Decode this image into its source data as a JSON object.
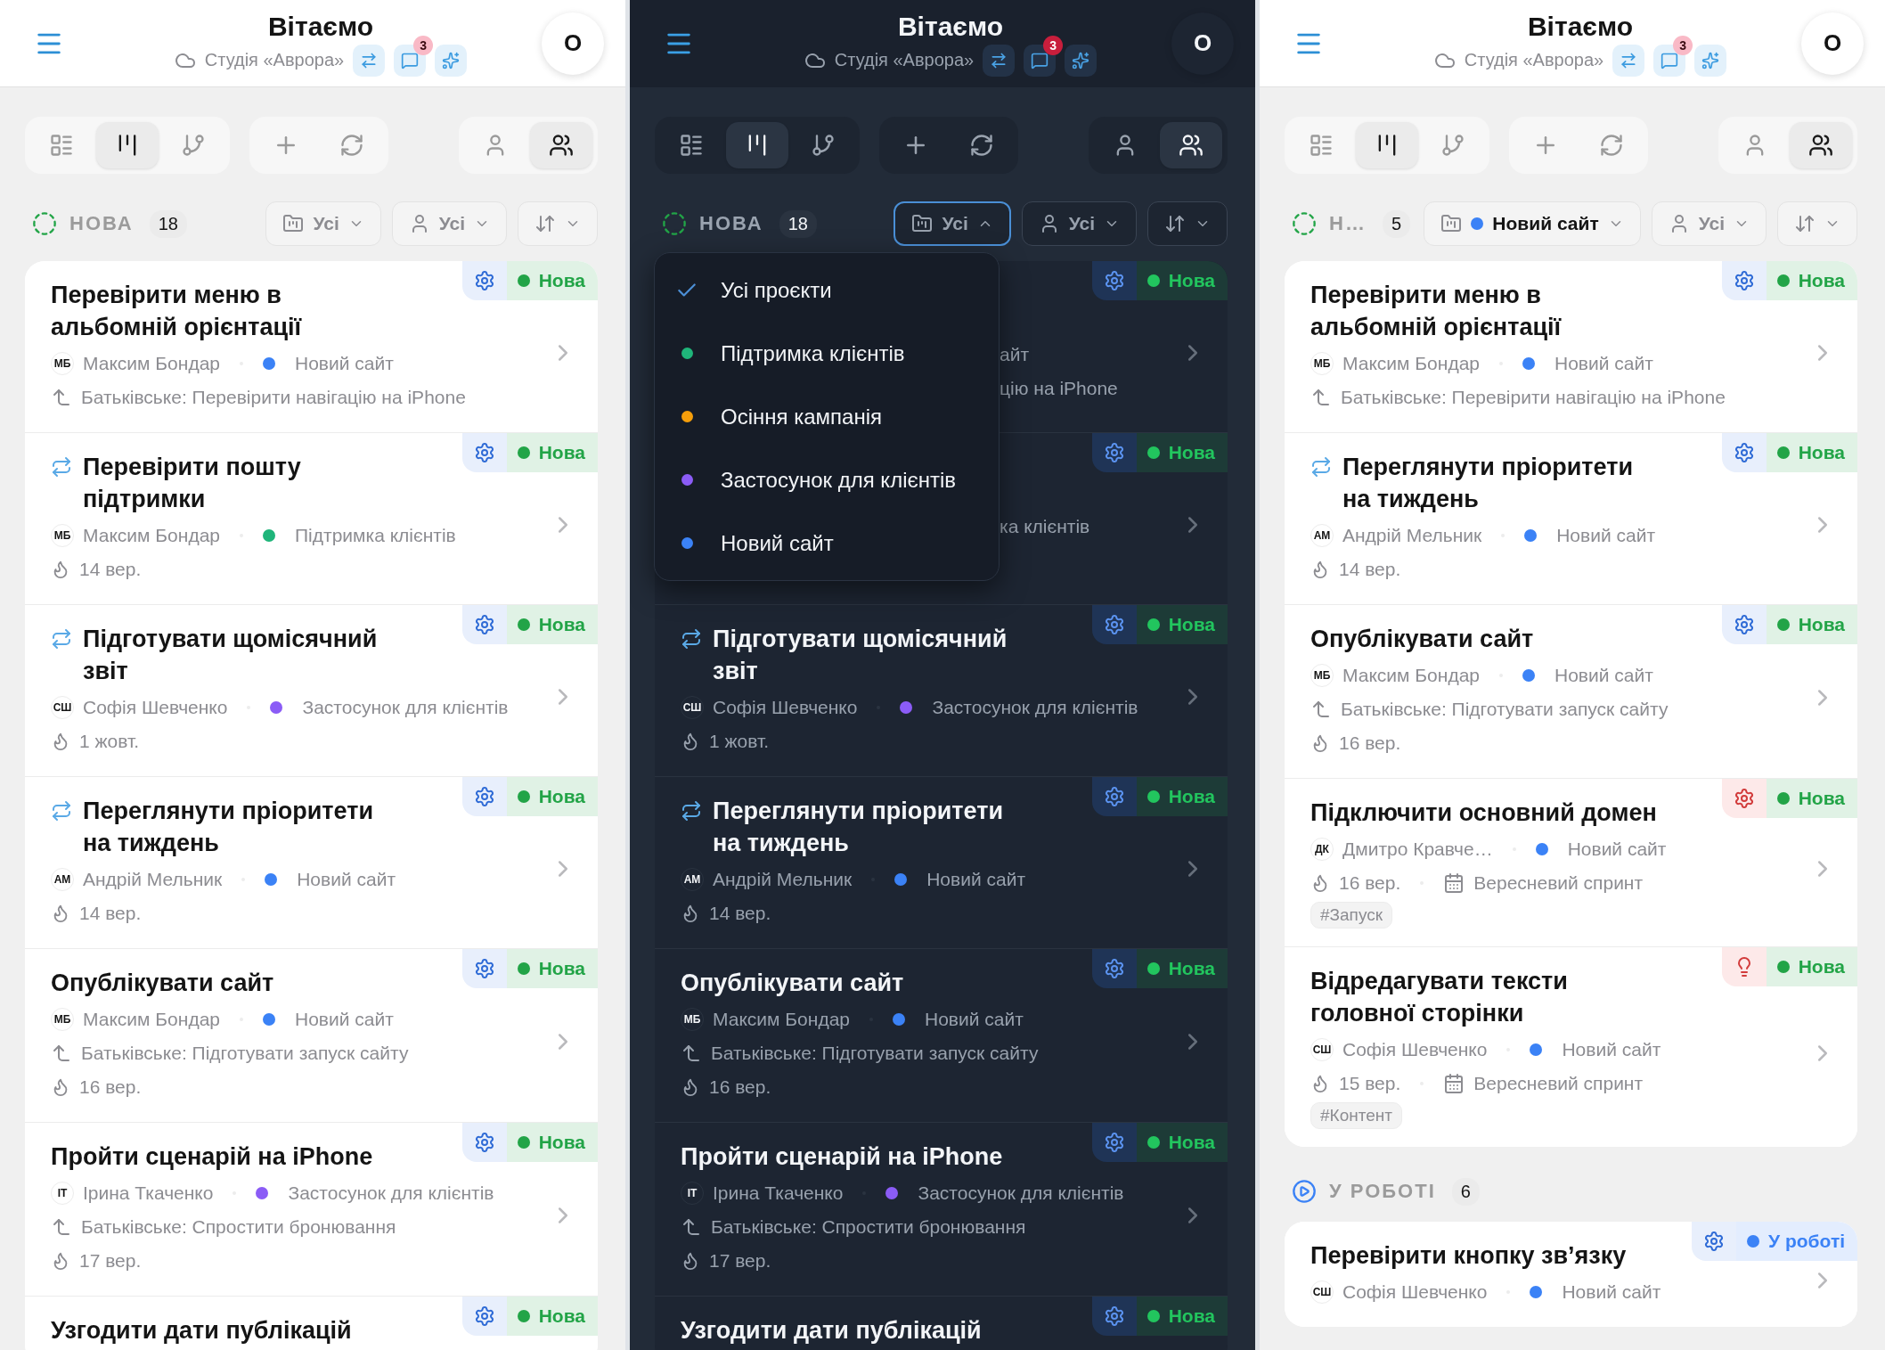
{
  "screens": [
    {
      "kind": "light",
      "header": {
        "title": "Вітаємо",
        "workspace": "Студія «Аврора»",
        "badge_count": "3",
        "avatar": "О"
      },
      "toolbar": {
        "views": [
          {
            "selected": false
          },
          {
            "selected": true
          },
          {
            "selected": false
          }
        ],
        "scope": [
          {
            "selected": false
          },
          {
            "selected": true
          }
        ]
      },
      "filters": {
        "project": {
          "label": "Усі",
          "open": false
        },
        "assignee": "Усі"
      },
      "groups": [
        {
          "kind": "new",
          "label": "НОВА",
          "count": "18",
          "cards": [
            {
              "kind": "full",
              "repeat": false,
              "title": [
                "Перевірити меню в",
                "альбомній орієнтації"
              ],
              "initials": "МБ",
              "assignee": "Максим Бондар",
              "project": {
                "name": "Новий сайт",
                "color": "#3b82f6"
              },
              "parent": "Батьківське: Перевірити навігацію на iPhone",
              "badge": {
                "kind": "gear",
                "urgent": false
              },
              "status": {
                "label": "Нова",
                "color": "#22a447"
              }
            },
            {
              "kind": "full",
              "repeat": true,
              "title": [
                "Перевірити пошту",
                "підтримки"
              ],
              "initials": "МБ",
              "assignee": "Максим Бондар",
              "project": {
                "name": "Підтримка клієнтів",
                "color": "#1fb57a"
              },
              "date": "14 вер.",
              "badge": {
                "kind": "gear",
                "urgent": false
              },
              "status": {
                "label": "Нова",
                "color": "#22a447"
              }
            },
            {
              "kind": "full",
              "repeat": true,
              "title": [
                "Підготувати щомісячний",
                "звіт"
              ],
              "initials": "СШ",
              "assignee": "Софія Шевченко",
              "project": {
                "name": "Застосунок для клієнтів",
                "color": "#8b5cf6"
              },
              "date": "1 жовт.",
              "badge": {
                "kind": "gear",
                "urgent": false
              },
              "status": {
                "label": "Нова",
                "color": "#22a447"
              }
            },
            {
              "kind": "full",
              "repeat": true,
              "title": [
                "Переглянути пріоритети",
                "на тиждень"
              ],
              "initials": "АМ",
              "assignee": "Андрій Мельник",
              "project": {
                "name": "Новий сайт",
                "color": "#3b82f6"
              },
              "date": "14 вер.",
              "badge": {
                "kind": "gear",
                "urgent": false
              },
              "status": {
                "label": "Нова",
                "color": "#22a447"
              }
            },
            {
              "kind": "full",
              "repeat": false,
              "title": [
                "Опублікувати сайт"
              ],
              "initials": "МБ",
              "assignee": "Максим Бондар",
              "project": {
                "name": "Новий сайт",
                "color": "#3b82f6"
              },
              "parent": "Батьківське: Підготувати запуск сайту",
              "date": "16 вер.",
              "badge": {
                "kind": "gear",
                "urgent": false
              },
              "status": {
                "label": "Нова",
                "color": "#22a447"
              }
            },
            {
              "kind": "full",
              "repeat": false,
              "title": [
                "Пройти сценарій на iPhone"
              ],
              "initials": "ІТ",
              "assignee": "Ірина Ткаченко",
              "project": {
                "name": "Застосунок для клієнтів",
                "color": "#8b5cf6"
              },
              "parent": "Батьківське: Спростити бронювання",
              "date": "17 вер.",
              "badge": {
                "kind": "gear",
                "urgent": false
              },
              "status": {
                "label": "Нова",
                "color": "#22a447"
              }
            },
            {
              "kind": "full",
              "repeat": false,
              "title": [
                "Узгодити дати публікацій"
              ],
              "badge": {
                "kind": "gear",
                "urgent": false
              },
              "status": {
                "label": "Нова",
                "color": "#22a447"
              }
            }
          ]
        }
      ]
    },
    {
      "kind": "dark",
      "header": {
        "title": "Вітаємо",
        "workspace": "Студія «Аврора»",
        "badge_count": "3",
        "avatar": "О"
      },
      "toolbar": {
        "views": [
          {
            "selected": false
          },
          {
            "selected": true
          },
          {
            "selected": false
          }
        ],
        "scope": [
          {
            "selected": false
          },
          {
            "selected": true
          }
        ]
      },
      "filters": {
        "project": {
          "label": "Усі",
          "open": true
        },
        "assignee": "Усі"
      },
      "dropdown": {
        "items": [
          {
            "label": "Усі проєкти",
            "selected": true
          },
          {
            "label": "Підтримка клієнтів",
            "selected": false,
            "color": "#1fb57a"
          },
          {
            "label": "Осіння кампанія",
            "selected": false,
            "color": "#f59e0b"
          },
          {
            "label": "Застосунок для клієнтів",
            "selected": false,
            "color": "#8b5cf6"
          },
          {
            "label": "Новий сайт",
            "selected": false,
            "color": "#3b82f6"
          }
        ]
      },
      "groups": [
        {
          "kind": "new",
          "label": "НОВА",
          "count": "18",
          "cards": [
            {
              "kind": "partial",
              "fragments": [
                "айт",
                "цію на iPhone"
              ],
              "badge": {
                "kind": "gear",
                "urgent": false
              },
              "status": {
                "label": "Нова",
                "color": "#22c55e"
              }
            },
            {
              "kind": "partial",
              "fragments": [
                "ка клієнтів"
              ],
              "badge": {
                "kind": "gear",
                "urgent": false
              },
              "status": {
                "label": "Нова",
                "color": "#22c55e"
              }
            },
            {
              "kind": "full",
              "repeat": true,
              "title": [
                "Підготувати щомісячний",
                "звіт"
              ],
              "initials": "СШ",
              "assignee": "Софія Шевченко",
              "project": {
                "name": "Застосунок для клієнтів",
                "color": "#8b5cf6"
              },
              "date": "1 жовт.",
              "badge": {
                "kind": "gear",
                "urgent": false
              },
              "status": {
                "label": "Нова",
                "color": "#22c55e"
              }
            },
            {
              "kind": "full",
              "repeat": true,
              "title": [
                "Переглянути пріоритети",
                "на тиждень"
              ],
              "initials": "АМ",
              "assignee": "Андрій Мельник",
              "project": {
                "name": "Новий сайт",
                "color": "#3b82f6"
              },
              "date": "14 вер.",
              "badge": {
                "kind": "gear",
                "urgent": false
              },
              "status": {
                "label": "Нова",
                "color": "#22c55e"
              }
            },
            {
              "kind": "full",
              "repeat": false,
              "title": [
                "Опублікувати сайт"
              ],
              "initials": "МБ",
              "assignee": "Максим Бондар",
              "project": {
                "name": "Новий сайт",
                "color": "#3b82f6"
              },
              "parent": "Батьківське: Підготувати запуск сайту",
              "date": "16 вер.",
              "badge": {
                "kind": "gear",
                "urgent": false
              },
              "status": {
                "label": "Нова",
                "color": "#22c55e"
              }
            },
            {
              "kind": "full",
              "repeat": false,
              "title": [
                "Пройти сценарій на iPhone"
              ],
              "initials": "ІТ",
              "assignee": "Ірина Ткаченко",
              "project": {
                "name": "Застосунок для клієнтів",
                "color": "#8b5cf6"
              },
              "parent": "Батьківське: Спростити бронювання",
              "date": "17 вер.",
              "badge": {
                "kind": "gear",
                "urgent": false
              },
              "status": {
                "label": "Нова",
                "color": "#22c55e"
              }
            },
            {
              "kind": "full",
              "repeat": false,
              "title": [
                "Узгодити дати публікацій"
              ],
              "badge": {
                "kind": "gear",
                "urgent": false
              },
              "status": {
                "label": "Нова",
                "color": "#22c55e"
              }
            }
          ]
        }
      ]
    },
    {
      "kind": "light",
      "header": {
        "title": "Вітаємо",
        "workspace": "Студія «Аврора»",
        "badge_count": "3",
        "avatar": "О"
      },
      "toolbar": {
        "views": [
          {
            "selected": false
          },
          {
            "selected": true
          },
          {
            "selected": false
          }
        ],
        "scope": [
          {
            "selected": false
          },
          {
            "selected": true
          }
        ]
      },
      "filters": {
        "project": {
          "label": "Новий сайт",
          "color": "#3b82f6",
          "open": false
        },
        "assignee": "Усі"
      },
      "groups": [
        {
          "kind": "new",
          "label": "Н…",
          "count": "5",
          "cards": [
            {
              "kind": "full",
              "repeat": false,
              "title": [
                "Перевірити меню в",
                "альбомній орієнтації"
              ],
              "initials": "МБ",
              "assignee": "Максим Бондар",
              "project": {
                "name": "Новий сайт",
                "color": "#3b82f6"
              },
              "parent": "Батьківське: Перевірити навігацію на iPhone",
              "badge": {
                "kind": "gear",
                "urgent": false
              },
              "status": {
                "label": "Нова",
                "color": "#22a447"
              }
            },
            {
              "kind": "full",
              "repeat": true,
              "title": [
                "Переглянути пріоритети",
                "на тиждень"
              ],
              "initials": "АМ",
              "assignee": "Андрій Мельник",
              "project": {
                "name": "Новий сайт",
                "color": "#3b82f6"
              },
              "date": "14 вер.",
              "badge": {
                "kind": "gear",
                "urgent": false
              },
              "status": {
                "label": "Нова",
                "color": "#22a447"
              }
            },
            {
              "kind": "full",
              "repeat": false,
              "title": [
                "Опублікувати сайт"
              ],
              "initials": "МБ",
              "assignee": "Максим Бондар",
              "project": {
                "name": "Новий сайт",
                "color": "#3b82f6"
              },
              "parent": "Батьківське: Підготувати запуск сайту",
              "date": "16 вер.",
              "badge": {
                "kind": "gear",
                "urgent": false
              },
              "status": {
                "label": "Нова",
                "color": "#22a447"
              }
            },
            {
              "kind": "full",
              "repeat": false,
              "title": [
                "Підключити основний домен"
              ],
              "initials": "ДК",
              "assignee": "Дмитро Кравче…",
              "project": {
                "name": "Новий сайт",
                "color": "#3b82f6"
              },
              "date": "16 вер.",
              "sprint": "Вересневий спринт",
              "tag": "#Запуск",
              "badge": {
                "kind": "gear",
                "urgent": true
              },
              "status": {
                "label": "Нова",
                "color": "#22a447"
              }
            },
            {
              "kind": "full",
              "repeat": false,
              "title": [
                "Відредагувати тексти",
                "головної сторінки"
              ],
              "initials": "СШ",
              "assignee": "Софія Шевченко",
              "project": {
                "name": "Новий сайт",
                "color": "#3b82f6"
              },
              "date": "15 вер.",
              "sprint": "Вересневий спринт",
              "tag": "#Контент",
              "badge": {
                "kind": "bulb",
                "urgent": true
              },
              "status": {
                "label": "Нова",
                "color": "#22a447"
              }
            }
          ]
        },
        {
          "kind": "progress",
          "label": "У РОБОТІ",
          "count": "6",
          "cards": [
            {
              "kind": "full",
              "repeat": false,
              "title": [
                "Перевірити кнопку зв’язку"
              ],
              "initials": "СШ",
              "assignee": "Софія Шевченко",
              "project": {
                "name": "Новий сайт",
                "color": "#3b82f6"
              },
              "badge": {
                "kind": "gear",
                "urgent": false
              },
              "status": {
                "label": "У роботі",
                "color": "#3b82f6"
              }
            }
          ]
        }
      ]
    }
  ]
}
